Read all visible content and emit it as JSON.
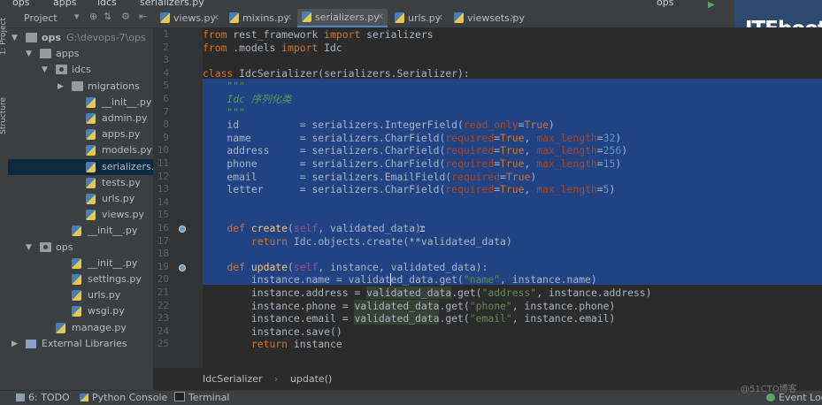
{
  "top_crumbs": [
    "ops",
    "apps",
    "idcs",
    "serializers.py"
  ],
  "toolbar": {
    "run_config": "ops"
  },
  "project_panel": {
    "title": "Project",
    "tree": [
      {
        "label": "ops",
        "path": "G:\\devops-7\\ops",
        "kind": "folder",
        "depth": 0,
        "open": true
      },
      {
        "label": "apps",
        "kind": "folder",
        "depth": 1,
        "open": true
      },
      {
        "label": "idcs",
        "kind": "package",
        "depth": 2,
        "open": true
      },
      {
        "label": "migrations",
        "kind": "folder",
        "depth": 3,
        "open": false
      },
      {
        "label": "__init__.py",
        "kind": "py",
        "depth": 4
      },
      {
        "label": "admin.py",
        "kind": "py",
        "depth": 4
      },
      {
        "label": "apps.py",
        "kind": "py",
        "depth": 4
      },
      {
        "label": "models.py",
        "kind": "py",
        "depth": 4
      },
      {
        "label": "serializers.py",
        "kind": "py",
        "depth": 4,
        "selected": true
      },
      {
        "label": "tests.py",
        "kind": "py",
        "depth": 4
      },
      {
        "label": "urls.py",
        "kind": "py",
        "depth": 4
      },
      {
        "label": "views.py",
        "kind": "py",
        "depth": 4
      },
      {
        "label": "__init__.py",
        "kind": "py",
        "depth": 3
      },
      {
        "label": "ops",
        "kind": "package",
        "depth": 1,
        "open": true
      },
      {
        "label": "__init__.py",
        "kind": "py",
        "depth": 3
      },
      {
        "label": "settings.py",
        "kind": "py",
        "depth": 3
      },
      {
        "label": "urls.py",
        "kind": "py",
        "depth": 3
      },
      {
        "label": "wsgi.py",
        "kind": "py",
        "depth": 3
      },
      {
        "label": "manage.py",
        "kind": "py",
        "depth": 2
      },
      {
        "label": "External Libraries",
        "kind": "lib",
        "depth": 0,
        "open": false
      }
    ]
  },
  "tabs": [
    {
      "label": "views.py",
      "active": false
    },
    {
      "label": "mixins.py",
      "active": false
    },
    {
      "label": "serializers.py",
      "active": true
    },
    {
      "label": "urls.py",
      "active": false
    },
    {
      "label": "viewsets.py",
      "active": false
    }
  ],
  "editor": {
    "line_numbers": [
      "1",
      "2",
      "3",
      "4",
      "5",
      "6",
      "7",
      "8",
      "9",
      "10",
      "11",
      "12",
      "13",
      "14",
      "15",
      "16",
      "17",
      "18",
      "19",
      "20",
      "21",
      "22",
      "23",
      "24",
      "25"
    ],
    "override_marks": [
      "16",
      "19"
    ],
    "lines": [
      [
        [
          "kw",
          "from"
        ],
        [
          "tx",
          " rest_framework "
        ],
        [
          "kw",
          "import"
        ],
        [
          "tx",
          " serializers"
        ]
      ],
      [
        [
          "kw",
          "from"
        ],
        [
          "tx",
          " .models "
        ],
        [
          "kw",
          "import"
        ],
        [
          "tx",
          " Idc"
        ]
      ],
      [],
      [
        [
          "kw",
          "class"
        ],
        [
          "tx",
          " IdcSerializer(serializers.Serializer):"
        ]
      ],
      [
        [
          "doc",
          "    \"\"\""
        ]
      ],
      [
        [
          "doc",
          "    Idc 序列化类"
        ]
      ],
      [
        [
          "doc",
          "    \"\"\""
        ]
      ],
      [
        [
          "tx",
          "    id          = serializers.IntegerField("
        ],
        [
          "pm",
          "read_only"
        ],
        [
          "tx",
          "="
        ],
        [
          "kw",
          "True"
        ],
        [
          "tx",
          ")"
        ]
      ],
      [
        [
          "tx",
          "    name        = serializers.CharField("
        ],
        [
          "pm",
          "required"
        ],
        [
          "tx",
          "="
        ],
        [
          "kw",
          "True"
        ],
        [
          "tx",
          ", "
        ],
        [
          "pm",
          "max_length"
        ],
        [
          "tx",
          "="
        ],
        [
          "num",
          "32"
        ],
        [
          "tx",
          ")"
        ]
      ],
      [
        [
          "tx",
          "    address     = serializers.CharField("
        ],
        [
          "pm",
          "required"
        ],
        [
          "tx",
          "="
        ],
        [
          "kw",
          "True"
        ],
        [
          "tx",
          ", "
        ],
        [
          "pm",
          "max_length"
        ],
        [
          "tx",
          "="
        ],
        [
          "num",
          "256"
        ],
        [
          "tx",
          ")"
        ]
      ],
      [
        [
          "tx",
          "    phone       = serializers.CharField("
        ],
        [
          "pm",
          "required"
        ],
        [
          "tx",
          "="
        ],
        [
          "kw",
          "True"
        ],
        [
          "tx",
          ", "
        ],
        [
          "pm",
          "max_length"
        ],
        [
          "tx",
          "="
        ],
        [
          "num",
          "15"
        ],
        [
          "tx",
          ")"
        ]
      ],
      [
        [
          "tx",
          "    email       = serializers.EmailField("
        ],
        [
          "pm",
          "required"
        ],
        [
          "tx",
          "="
        ],
        [
          "kw",
          "True"
        ],
        [
          "tx",
          ")"
        ]
      ],
      [
        [
          "tx",
          "    letter      = serializers.CharField("
        ],
        [
          "pm",
          "required"
        ],
        [
          "tx",
          "="
        ],
        [
          "kw",
          "True"
        ],
        [
          "tx",
          ", "
        ],
        [
          "pm",
          "max_length"
        ],
        [
          "tx",
          "="
        ],
        [
          "num",
          "5"
        ],
        [
          "tx",
          ")"
        ]
      ],
      [],
      [],
      [
        [
          "tx",
          "    "
        ],
        [
          "kw",
          "def"
        ],
        [
          "tx",
          " "
        ],
        [
          "fn",
          "create"
        ],
        [
          "tx",
          "("
        ],
        [
          "slf",
          "self"
        ],
        [
          "tx",
          ", validated_data):"
        ]
      ],
      [
        [
          "tx",
          "        "
        ],
        [
          "kw",
          "return"
        ],
        [
          "tx",
          " Idc.objects.create(**validated_data)"
        ]
      ],
      [],
      [
        [
          "tx",
          "    "
        ],
        [
          "kw",
          "def"
        ],
        [
          "tx",
          " "
        ],
        [
          "fn",
          "update"
        ],
        [
          "tx",
          "("
        ],
        [
          "slf",
          "self"
        ],
        [
          "tx",
          ", instance, validated_data):"
        ]
      ],
      [
        [
          "tx",
          "        instance.name = validated_data.get("
        ],
        [
          "str",
          "\"name\""
        ],
        [
          "tx",
          ", instance.name)"
        ]
      ],
      [
        [
          "tx",
          "        instance.address = "
        ],
        [
          "hl",
          "validated_data"
        ],
        [
          "tx",
          ".get("
        ],
        [
          "str",
          "\"address\""
        ],
        [
          "tx",
          ", instance.address)"
        ]
      ],
      [
        [
          "tx",
          "        instance.phone = "
        ],
        [
          "hl",
          "validated_data"
        ],
        [
          "tx",
          ".get("
        ],
        [
          "str",
          "\"phone\""
        ],
        [
          "tx",
          ", instance.phone)"
        ]
      ],
      [
        [
          "tx",
          "        instance.email = "
        ],
        [
          "hl",
          "validated_data"
        ],
        [
          "tx",
          ".get("
        ],
        [
          "str",
          "\"email\""
        ],
        [
          "tx",
          ", instance.email)"
        ]
      ],
      [
        [
          "tx",
          "        instance.save()"
        ]
      ],
      [
        [
          "tx",
          "        "
        ],
        [
          "kw",
          "return"
        ],
        [
          "tx",
          " instance"
        ]
      ]
    ]
  },
  "breadcrumb": [
    "IdcSerializer",
    "update()"
  ],
  "bottom_bar": {
    "todo": "6: TODO",
    "python_console": "Python Console",
    "terminal": "Terminal",
    "event_log": "Event Log"
  },
  "logo_text": "ITEboot",
  "watermark": "@51CTO博客",
  "left_stripe": [
    "1: Project",
    "Structure"
  ]
}
